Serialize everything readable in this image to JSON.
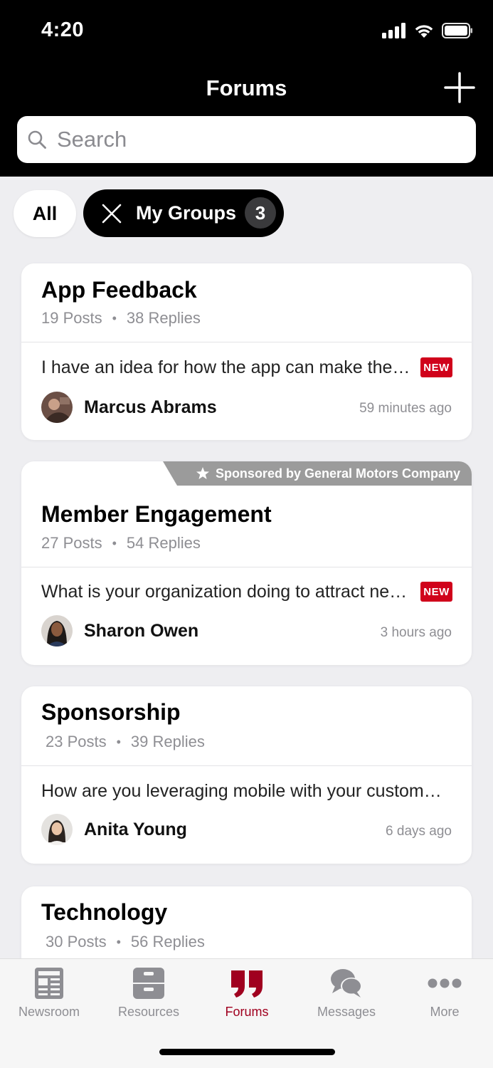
{
  "status_bar": {
    "time": "4:20"
  },
  "header": {
    "title": "Forums"
  },
  "search": {
    "placeholder": "Search"
  },
  "filters": {
    "all_label": "All",
    "groups_label": "My Groups",
    "groups_count": "3"
  },
  "forums": [
    {
      "title": "App Feedback",
      "posts": "19 Posts",
      "replies": "38 Replies",
      "preview": "I have an idea for how the app can make the experience better",
      "badge": "NEW",
      "author": "Marcus Abrams",
      "time": "59 minutes ago"
    },
    {
      "sponsor": "Sponsored by General Motors Company",
      "title": "Member Engagement",
      "posts": "27 Posts",
      "replies": "54 Replies",
      "preview": "What is your organization doing to attract new members",
      "badge": "NEW",
      "author": "Sharon Owen",
      "time": "3 hours ago"
    },
    {
      "title": "Sponsorship",
      "posts": "23 Posts",
      "replies": "39 Replies",
      "preview": "How are you leveraging mobile with your customers and sponsors",
      "author": "Anita Young",
      "time": "6 days ago"
    },
    {
      "title": "Technology",
      "posts": "30 Posts",
      "replies": "56 Replies"
    }
  ],
  "tabs": [
    {
      "label": "Newsroom",
      "icon": "newspaper-icon"
    },
    {
      "label": "Resources",
      "icon": "archive-box-icon"
    },
    {
      "label": "Forums",
      "icon": "quote-icon",
      "active": true
    },
    {
      "label": "Messages",
      "icon": "chat-bubbles-icon"
    },
    {
      "label": "More",
      "icon": "ellipsis-icon"
    }
  ],
  "colors": {
    "header_bg": "#000000",
    "accent": "#A0001F",
    "badge_new": "#D0021B",
    "page_bg": "#EEEEF1"
  }
}
